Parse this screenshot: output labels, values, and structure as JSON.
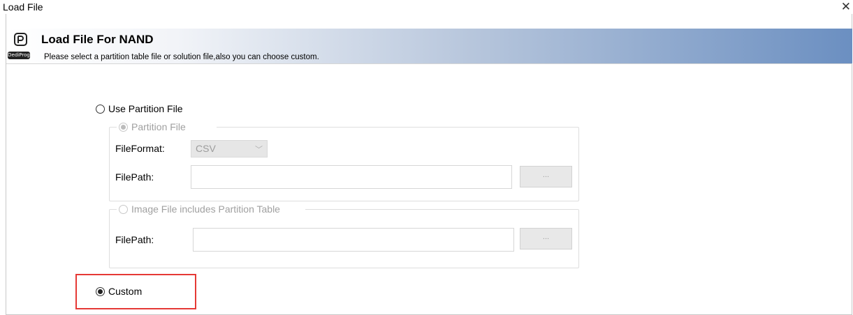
{
  "window": {
    "title": "Load File",
    "close_glyph": "✕"
  },
  "header": {
    "title": "Load File For NAND",
    "subtitle": "Please select a partition table file or solution file,also you can choose custom.",
    "logo_badge": "DediProg",
    "logo_icon": "dediprog-logo-icon"
  },
  "options": {
    "use_partition_file": {
      "label": "Use Partition File",
      "checked": false
    },
    "partition_file": {
      "label": "Partition File",
      "checked": true,
      "disabled": true,
      "file_format_label": "FileFormat:",
      "file_format_value": "CSV",
      "file_path_label": "FilePath:",
      "file_path_value": "",
      "browse_label": "..."
    },
    "image_file": {
      "label": "Image File includes Partition Table",
      "checked": false,
      "disabled": true,
      "file_path_label": "FilePath:",
      "file_path_value": "",
      "browse_label": "..."
    },
    "custom": {
      "label": "Custom",
      "checked": true
    }
  },
  "colors": {
    "highlight_border": "#e53935",
    "banner_gradient_end": "#6b8fc1"
  }
}
